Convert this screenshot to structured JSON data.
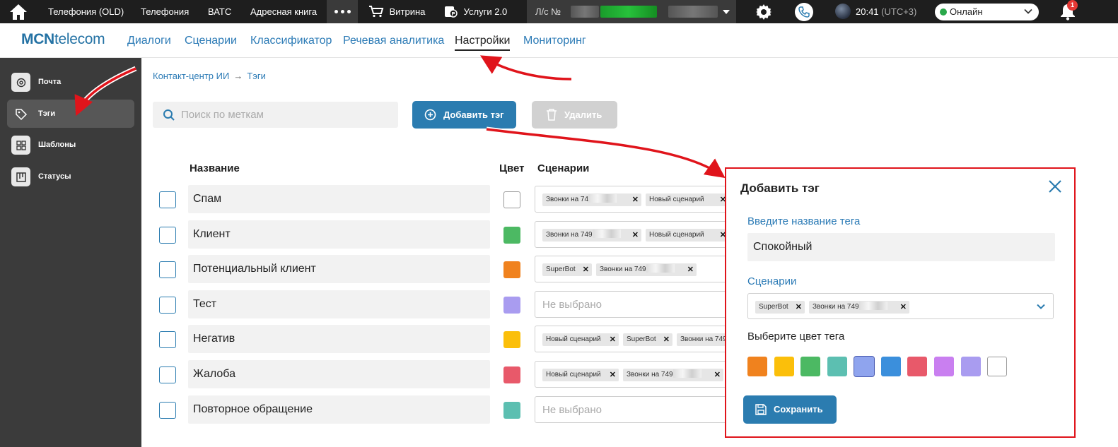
{
  "topbar": {
    "items": [
      "Телефония (OLD)",
      "Телефония",
      "ВАТС",
      "Адресная книга"
    ],
    "store": "Витрина",
    "services": "Услуги 2.0",
    "account_label": "Л/с №",
    "time": "20:41",
    "timezone": "(UTC+3)",
    "status": "Онлайн",
    "notifications": "1"
  },
  "header": {
    "logo_bold": "MCN",
    "logo_rest": "telecom",
    "nav": [
      "Диалоги",
      "Сценарии",
      "Классификатор",
      "Речевая аналитика",
      "Настройки",
      "Мониторинг"
    ],
    "active_nav": "Настройки"
  },
  "sidebar": {
    "items": [
      {
        "label": "Почта",
        "icon": "gear-icon"
      },
      {
        "label": "Тэги",
        "icon": "tag-icon"
      },
      {
        "label": "Шаблоны",
        "icon": "grid-icon"
      },
      {
        "label": "Статусы",
        "icon": "board-icon"
      }
    ],
    "active": "Тэги"
  },
  "breadcrumb": {
    "root": "Контакт-центр ИИ",
    "current": "Тэги"
  },
  "search": {
    "placeholder": "Поиск по меткам"
  },
  "buttons": {
    "add": "Добавить тэг",
    "delete": "Удалить"
  },
  "table": {
    "headers": {
      "name": "Название",
      "color": "Цвет",
      "scenarios": "Сценарии"
    },
    "placeholder": "Не выбрано",
    "rows": [
      {
        "name": "Спам",
        "color": "#ffffff",
        "chips": [
          "Звонки на 74",
          "Новый сценарий"
        ]
      },
      {
        "name": "Клиент",
        "color": "#4cb963",
        "chips": [
          "Звонки на 749",
          "Новый сценарий"
        ]
      },
      {
        "name": "Потенциальный клиент",
        "color": "#f0821e",
        "chips": [
          "SuperBot",
          "Звонки на 749"
        ]
      },
      {
        "name": "Тест",
        "color": "#a99cf0",
        "chips": []
      },
      {
        "name": "Негатив",
        "color": "#fbbf0a",
        "chips": [
          "Новый сценарий",
          "SuperBot",
          "Звонки на 749"
        ]
      },
      {
        "name": "Жалоба",
        "color": "#e8596a",
        "chips": [
          "Новый сценарий",
          "Звонки на 749"
        ]
      },
      {
        "name": "Повторное обращение",
        "color": "#5cbfb1",
        "chips": []
      }
    ]
  },
  "modal": {
    "title": "Добавить тэг",
    "name_label": "Введите название тега",
    "name_value": "Спокойный",
    "scenarios_label": "Сценарии",
    "scenarios_chips": [
      "SuperBot",
      "Звонки на 749"
    ],
    "color_label": "Выберите цвет тега",
    "colors": [
      "#f0821e",
      "#fbbf0a",
      "#4cb963",
      "#5cbfb1",
      "#8fa4ee",
      "#3b8fdc",
      "#e8596a",
      "#c97ff0",
      "#a99cf0",
      "#ffffff"
    ],
    "selected_color": "#8fa4ee",
    "save": "Сохранить"
  }
}
